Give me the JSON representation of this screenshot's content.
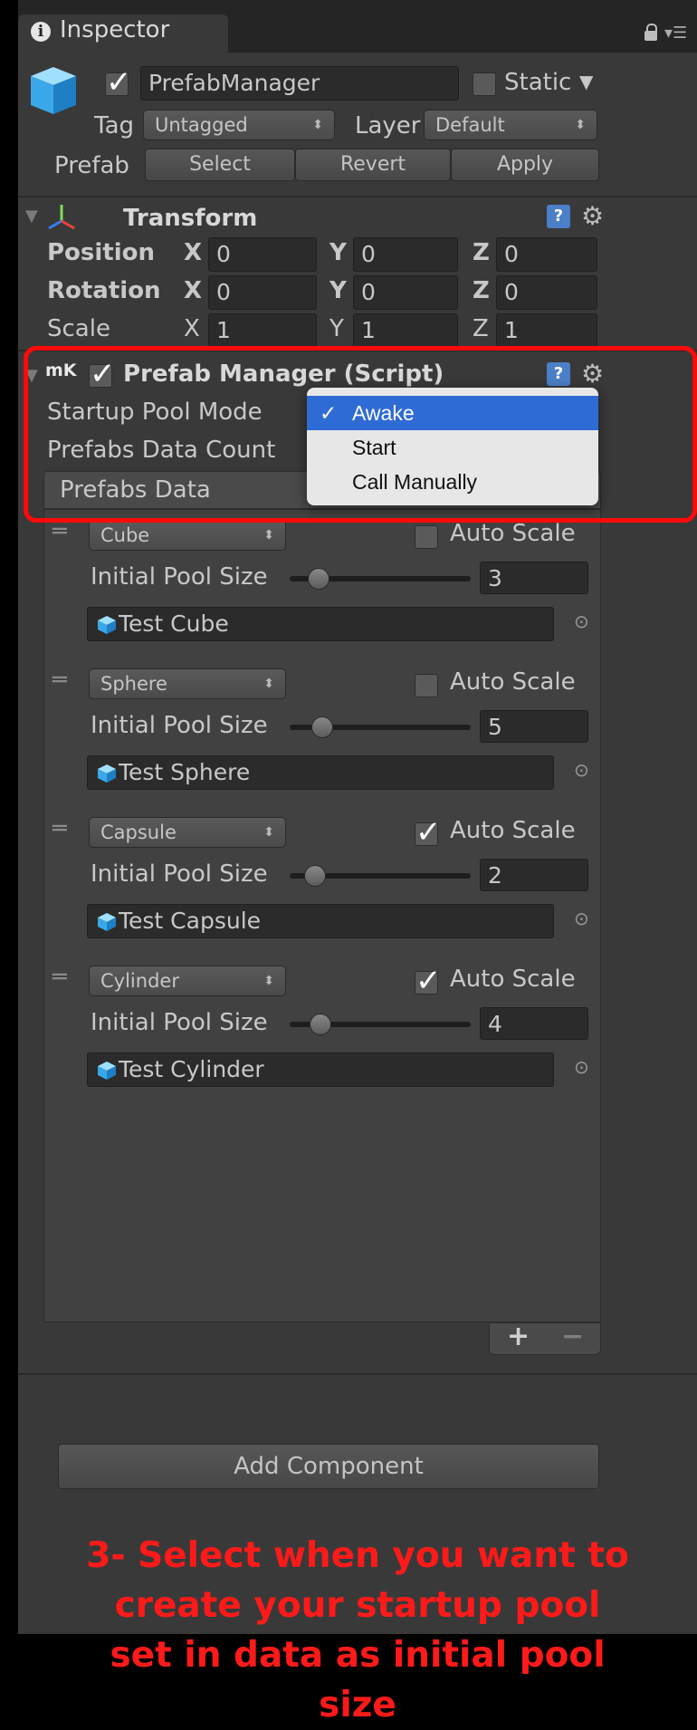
{
  "tab": {
    "title": "Inspector"
  },
  "header": {
    "object_name": "PrefabManager",
    "static_label": "Static",
    "tag_label": "Tag",
    "tag_value": "Untagged",
    "layer_label": "Layer",
    "layer_value": "Default",
    "prefab_label": "Prefab",
    "select_label": "Select",
    "revert_label": "Revert",
    "apply_label": "Apply"
  },
  "transform": {
    "title": "Transform",
    "rows": [
      {
        "label": "Position",
        "x": "0",
        "y": "0",
        "z": "0"
      },
      {
        "label": "Rotation",
        "x": "0",
        "y": "0",
        "z": "0"
      },
      {
        "label": "Scale",
        "x": "1",
        "y": "1",
        "z": "1"
      }
    ],
    "axis_x": "X",
    "axis_y": "Y",
    "axis_z": "Z"
  },
  "script": {
    "title": "Prefab Manager (Script)",
    "startup_label": "Startup Pool Mode",
    "count_label": "Prefabs Data Count",
    "list_title": "Prefabs Data",
    "dropdown": {
      "options": [
        "Awake",
        "Start",
        "Call Manually"
      ],
      "selected": "Awake"
    }
  },
  "prefabs": [
    {
      "type": "Cube",
      "auto_scale": false,
      "pool_label": "Initial Pool Size",
      "pool_size": "3",
      "pool_fraction": 0.1,
      "object": "Test Cube"
    },
    {
      "type": "Sphere",
      "auto_scale": false,
      "pool_label": "Initial Pool Size",
      "pool_size": "5",
      "pool_fraction": 0.12,
      "object": "Test Sphere"
    },
    {
      "type": "Capsule",
      "auto_scale": true,
      "pool_label": "Initial Pool Size",
      "pool_size": "2",
      "pool_fraction": 0.08,
      "object": "Test Capsule"
    },
    {
      "type": "Cylinder",
      "auto_scale": true,
      "pool_label": "Initial Pool Size",
      "pool_size": "4",
      "pool_fraction": 0.11,
      "object": "Test Cylinder"
    }
  ],
  "auto_scale_label": "Auto Scale",
  "list_footer": {
    "plus": "+",
    "minus": "−"
  },
  "add_component": "Add Component",
  "caption_lines": [
    "3- Select when you want to",
    "create your startup pool",
    "set in data as initial pool",
    "size"
  ],
  "colors": {
    "highlight": "#ff0a0a",
    "menu_selected": "#2f6bd5"
  }
}
